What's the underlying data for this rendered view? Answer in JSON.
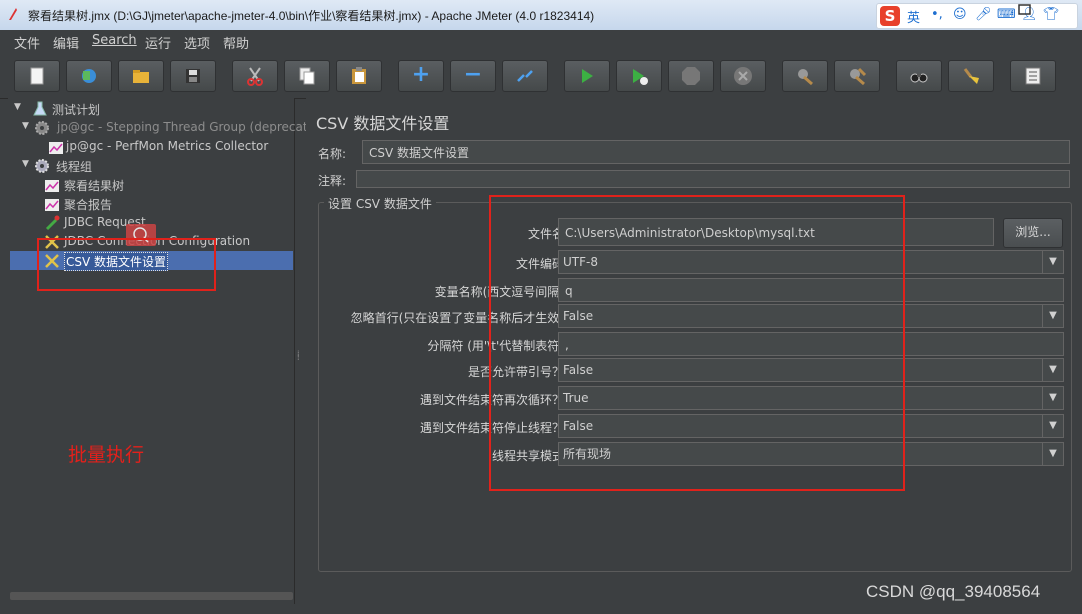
{
  "window": {
    "title": "察看结果树.jmx (D:\\GJ\\jmeter\\apache-jmeter-4.0\\bin\\作业\\察看结果树.jmx) - Apache JMeter (4.0 r1823414)",
    "ime": {
      "logo": "S",
      "lang": "英"
    }
  },
  "menu": {
    "items": [
      "文件",
      "编辑",
      "Search",
      "运行",
      "选项",
      "帮助"
    ]
  },
  "toolbar": {
    "buttons": [
      {
        "name": "new-icon"
      },
      {
        "name": "templates-icon"
      },
      {
        "name": "open-icon"
      },
      {
        "name": "save-icon"
      },
      {
        "name": "cut-icon"
      },
      {
        "name": "copy-icon"
      },
      {
        "name": "paste-icon"
      },
      {
        "name": "expand-icon"
      },
      {
        "name": "collapse-icon"
      },
      {
        "name": "toggle-icon"
      },
      {
        "name": "start-icon"
      },
      {
        "name": "start-no-pause-icon"
      },
      {
        "name": "stop-icon"
      },
      {
        "name": "shutdown-icon"
      },
      {
        "name": "clear-icon"
      },
      {
        "name": "clear-all-icon"
      },
      {
        "name": "search-icon"
      },
      {
        "name": "reset-search-icon"
      },
      {
        "name": "function-helper-icon"
      }
    ],
    "plus": "+",
    "minus": "−",
    "stop_text": "STOP"
  },
  "tree": {
    "items": [
      {
        "label": "测试计划",
        "depth": 0
      },
      {
        "label": "jp@gc - Stepping Thread Group (deprecate",
        "depth": 1,
        "disabled": true
      },
      {
        "label": "jp@gc - PerfMon Metrics Collector",
        "depth": 2
      },
      {
        "label": "线程组",
        "depth": 1
      },
      {
        "label": "察看结果树",
        "depth": 2
      },
      {
        "label": "聚合报告",
        "depth": 2
      },
      {
        "label": "JDBC Request",
        "depth": 2
      },
      {
        "label": "JDBC Connection Configuration",
        "depth": 2
      },
      {
        "label": "CSV 数据文件设置",
        "depth": 2,
        "selected": true
      }
    ],
    "annotation": "批量执行"
  },
  "panel": {
    "title": "CSV 数据文件设置",
    "name_label": "名称:",
    "name_value": "CSV 数据文件设置",
    "comment_label": "注释:",
    "comment_value": "",
    "group_title": "设置 CSV 数据文件",
    "browse_label": "浏览...",
    "fields": [
      {
        "label": "文件名:",
        "value": "C:\\Users\\Administrator\\Desktop\\mysql.txt",
        "kind": "text"
      },
      {
        "label": "文件编码:",
        "value": "UTF-8",
        "kind": "combo"
      },
      {
        "label": "变量名称(西文逗号间隔):",
        "value": "q",
        "kind": "text"
      },
      {
        "label": "忽略首行(只在设置了变量名称后才生效):",
        "value": "False",
        "kind": "combo"
      },
      {
        "label": "分隔符 (用'\\t'代替制表符):",
        "value": ",",
        "kind": "text"
      },
      {
        "label": "是否允许带引号？:",
        "value": "False",
        "kind": "combo"
      },
      {
        "label": "遇到文件结束符再次循环？:",
        "value": "True",
        "kind": "combo"
      },
      {
        "label": "遇到文件结束符停止线程？:",
        "value": "False",
        "kind": "combo"
      },
      {
        "label": "线程共享模式:",
        "value": "所有现场",
        "kind": "combo"
      }
    ]
  },
  "watermark": "CSDN @qq_39408564",
  "colors": {
    "background": "#3c3f41",
    "selection": "#4b6eaf",
    "annotation_red": "#e0221b"
  }
}
